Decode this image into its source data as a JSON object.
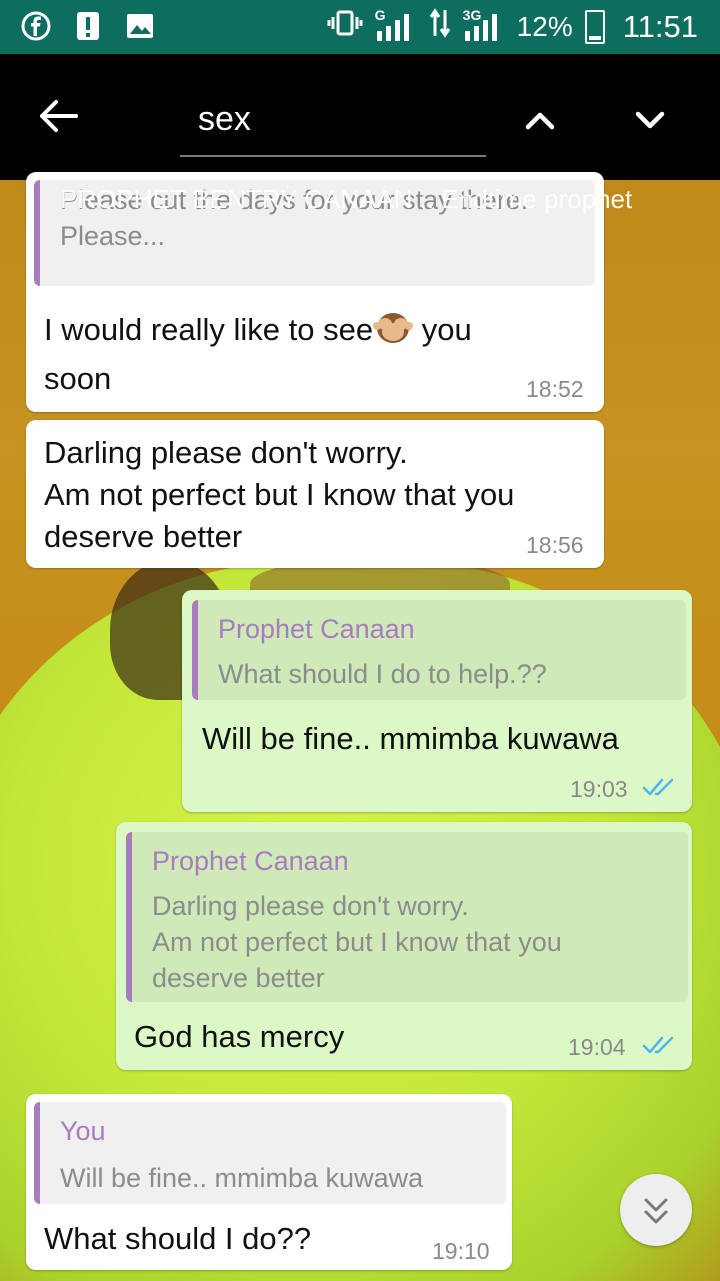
{
  "status_bar": {
    "battery_percent": "12%",
    "time": "11:51",
    "network_1": "G",
    "network_2": "3G"
  },
  "search": {
    "query": "sex"
  },
  "sender_overlay": "PROPHET BENTRY CANAAN... Endtime prophet",
  "messages": [
    {
      "direction": "incoming",
      "quote": {
        "text": "Please cut the days for your stay there.\nPlease..."
      },
      "text_before_emoji": "I would really like to see",
      "emoji": "see-no-evil-monkey",
      "text_after_emoji": " you",
      "text_line2": "soon",
      "time": "18:52"
    },
    {
      "direction": "incoming",
      "text": "Darling please don't worry.\nAm not perfect but I know that you\ndeserve better",
      "time": "18:56"
    },
    {
      "direction": "outgoing",
      "quote": {
        "name": "Prophet Canaan",
        "text": "What should I do to help.??"
      },
      "text": "Will be fine.. mmimba kuwawa",
      "time": "19:03"
    },
    {
      "direction": "outgoing",
      "quote": {
        "name": "Prophet Canaan",
        "text": "Darling please don't worry.\nAm not perfect but I know that you\ndeserve better"
      },
      "text": "God has mercy",
      "time": "19:04"
    },
    {
      "direction": "incoming",
      "quote": {
        "name": "You",
        "text": "Will be fine.. mmimba kuwawa"
      },
      "text": "What should I do??",
      "time": "19:10"
    }
  ],
  "colors": {
    "status_bar": "#0d6d5f",
    "outgoing_bubble": "#dcf8c6",
    "incoming_bubble": "#ffffff",
    "quote_accent": "#a97bbf",
    "read_ticks": "#4fb6ec"
  }
}
